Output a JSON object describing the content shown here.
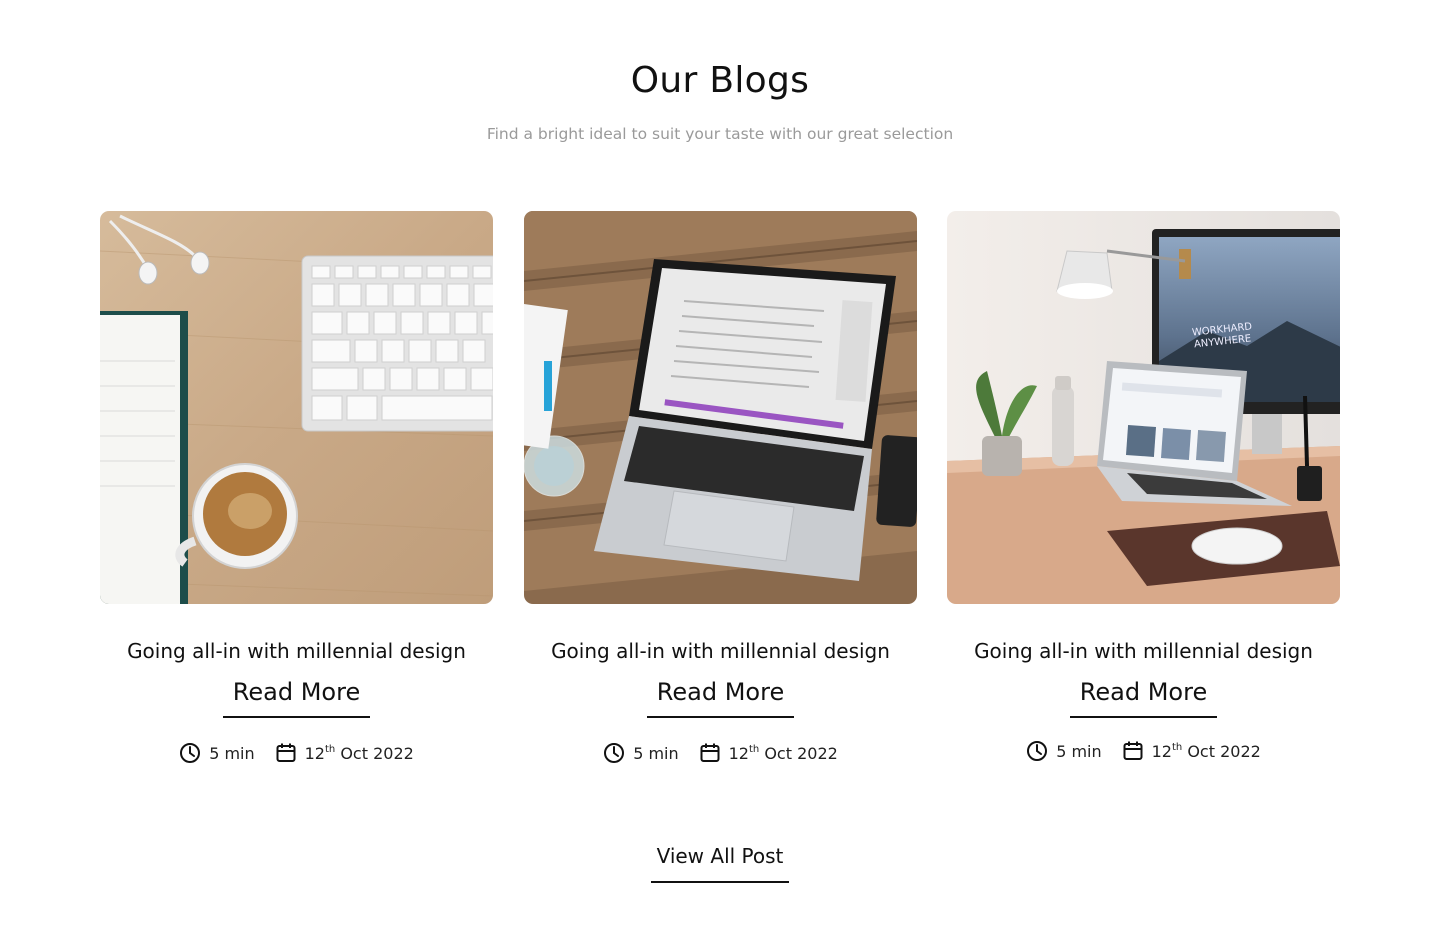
{
  "header": {
    "title": "Our Blogs",
    "subtitle": "Find a bright ideal to suit your taste with our great selection"
  },
  "posts": [
    {
      "image": "desk-keyboard-coffee-photo",
      "title": "Going all-in with millennial design",
      "read_more": "Read More",
      "read_time": "5 min",
      "date_day": "12",
      "date_suffix": "th",
      "date_rest": " Oct 2022"
    },
    {
      "image": "laptop-on-wooden-table-photo",
      "title": "Going all-in with millennial design",
      "read_more": "Read More",
      "read_time": "5 min",
      "date_day": "12",
      "date_suffix": "th",
      "date_rest": " Oct 2022"
    },
    {
      "image": "workspace-monitor-laptop-photo",
      "title": "Going all-in with millennial design",
      "read_more": "Read More",
      "read_time": "5 min",
      "date_day": "12",
      "date_suffix": "th",
      "date_rest": " Oct 2022"
    }
  ],
  "footer": {
    "view_all": "View All Post"
  },
  "icons": {
    "time": "clock-icon",
    "date": "calendar-icon"
  },
  "colors": {
    "text": "#111111",
    "muted": "#9a9a9a",
    "background": "#ffffff"
  }
}
